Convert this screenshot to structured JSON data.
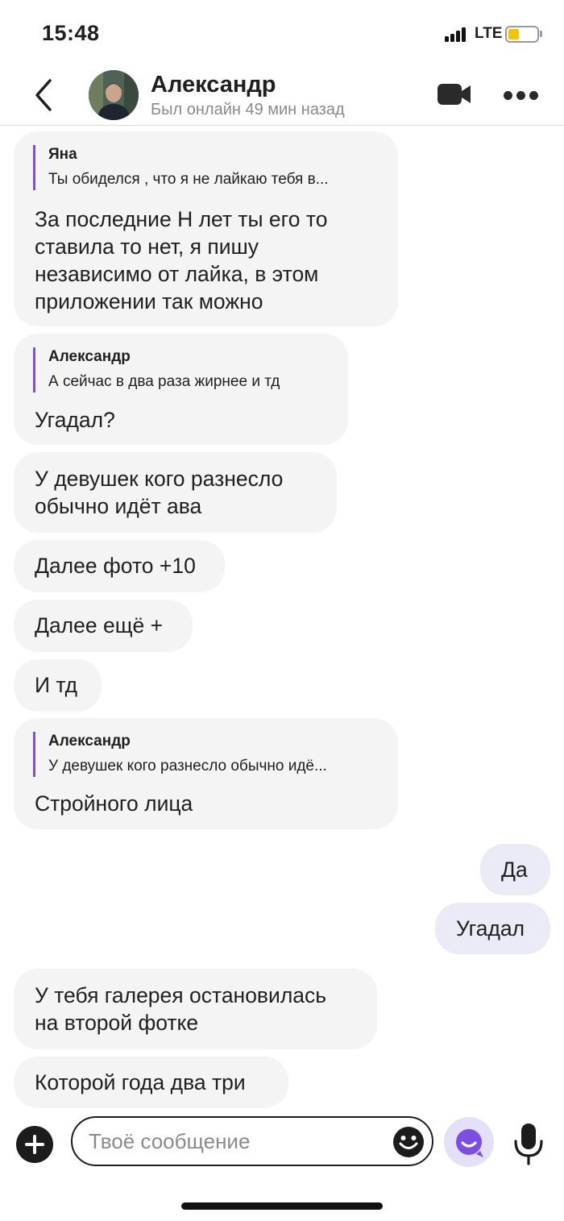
{
  "status_bar": {
    "time": "15:48",
    "network": "LTE",
    "battery_color": "#f5c400"
  },
  "header": {
    "contact_name": "Александр",
    "contact_status": "Был онлайн 49 мин назад",
    "icons": {
      "back": "chevron-left-icon",
      "video": "video-camera-icon",
      "more": "more-dots-icon"
    }
  },
  "messages": [
    {
      "direction": "in",
      "quote_author": "Яна",
      "quote_text": "Ты обиделся , что я не лайкаю тебя в...",
      "lines": [
        "За последние Н лет ты его то",
        "ставила то нет, я пишу",
        "независимо от лайка, в этом",
        "приложении так можно"
      ]
    },
    {
      "direction": "in",
      "quote_author": "Александр",
      "quote_text": "А сейчас в два раза жирнее и тд",
      "lines": [
        "Угадал?"
      ]
    },
    {
      "direction": "in",
      "lines": [
        "У девушек кого разнесло",
        "обычно идёт ава"
      ]
    },
    {
      "direction": "in",
      "lines": [
        "Далее фото +10"
      ]
    },
    {
      "direction": "in",
      "lines": [
        "Далее ещё +"
      ]
    },
    {
      "direction": "in",
      "lines": [
        "И тд"
      ]
    },
    {
      "direction": "in",
      "quote_author": "Александр",
      "quote_text": "У девушек кого разнесло обычно идё...",
      "lines": [
        "Стройного лица"
      ]
    },
    {
      "direction": "out",
      "lines": [
        "Да"
      ]
    },
    {
      "direction": "out",
      "lines": [
        "Угадал"
      ]
    },
    {
      "direction": "in",
      "lines": [
        "У тебя галерея остановилась",
        "на второй фотке"
      ]
    },
    {
      "direction": "in",
      "lines": [
        "Которой года два три"
      ]
    }
  ],
  "composer": {
    "placeholder": "Твоё сообщение",
    "value": "",
    "icons": {
      "add": "plus-icon",
      "emoji": "emoji-icon",
      "assistant": "assistant-icon",
      "mic": "microphone-icon"
    }
  },
  "colors": {
    "accent": "#7b4fe6",
    "incoming_bubble": "#f4f4f4",
    "outgoing_bubble": "#ebebf7"
  }
}
